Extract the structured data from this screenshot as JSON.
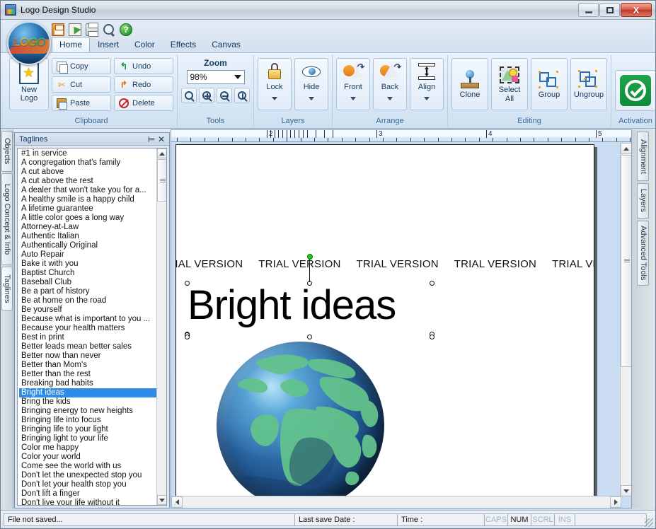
{
  "window": {
    "title": "Logo Design Studio",
    "app_icon": "app-logo-icon",
    "minimize": "–",
    "maximize": "□",
    "close": "X"
  },
  "quick_access": [
    {
      "name": "save-icon",
      "tooltip": "Save"
    },
    {
      "name": "save-as-icon",
      "tooltip": "Save As"
    },
    {
      "name": "print-icon",
      "tooltip": "Print"
    },
    {
      "name": "print-preview-icon",
      "tooltip": "Preview"
    },
    {
      "name": "help-icon",
      "tooltip": "Help",
      "glyph": "?"
    }
  ],
  "tabs": [
    {
      "label": "Home",
      "active": true
    },
    {
      "label": "Insert",
      "active": false
    },
    {
      "label": "Color",
      "active": false
    },
    {
      "label": "Effects",
      "active": false
    },
    {
      "label": "Canvas",
      "active": false
    }
  ],
  "ribbon": {
    "new_logo": {
      "line1": "New",
      "line2": "Logo"
    },
    "clipboard": {
      "label": "Clipboard",
      "buttons": [
        {
          "label": "Copy",
          "icon": "copy-icon"
        },
        {
          "label": "Cut",
          "icon": "cut-icon"
        },
        {
          "label": "Paste",
          "icon": "paste-icon"
        },
        {
          "label": "Undo",
          "icon": "undo-icon"
        },
        {
          "label": "Redo",
          "icon": "redo-icon"
        },
        {
          "label": "Delete",
          "icon": "delete-icon"
        }
      ]
    },
    "zoom": {
      "title": "Zoom",
      "value": "98%",
      "group_label": "Tools",
      "tools": [
        {
          "name": "zoom-select-icon"
        },
        {
          "name": "zoom-in-icon"
        },
        {
          "name": "zoom-out-icon"
        },
        {
          "name": "zoom-fit-icon"
        }
      ]
    },
    "layers": {
      "label": "Layers",
      "buttons": [
        {
          "label": "Lock",
          "icon": "lock-icon"
        },
        {
          "label": "Hide",
          "icon": "eye-icon"
        }
      ]
    },
    "arrange": {
      "label": "Arrange",
      "buttons": [
        {
          "label": "Front",
          "icon": "bring-front-icon"
        },
        {
          "label": "Back",
          "icon": "send-back-icon"
        },
        {
          "label": "Align",
          "icon": "align-icon"
        }
      ]
    },
    "editing": {
      "label": "Editing",
      "buttons": [
        {
          "label": "Clone",
          "icon": "clone-icon"
        },
        {
          "label": "Select All",
          "line1": "Select",
          "line2": "All",
          "icon": "select-all-icon"
        },
        {
          "label": "Group",
          "icon": "group-icon"
        },
        {
          "label": "Ungroup",
          "icon": "ungroup-icon"
        }
      ]
    },
    "activation": {
      "label": "Activation",
      "icon": "activation-check-icon"
    }
  },
  "left_tabs": [
    {
      "label": "Objects",
      "selected": false
    },
    {
      "label": "Logo Concept & Info",
      "selected": false
    },
    {
      "label": "Taglines",
      "selected": true
    }
  ],
  "right_tabs": [
    {
      "label": "Alignment"
    },
    {
      "label": "Layers"
    },
    {
      "label": "Advanced Tools"
    }
  ],
  "panel": {
    "title": "Taglines",
    "pin_icon": "pin-icon",
    "close_icon": "close-icon",
    "selected": "Bright ideas",
    "items": [
      "#1 in service",
      "A congregation that's family",
      "A cut above",
      "A cut above the rest",
      "A dealer that won't take you for a...",
      "A healthy smile is a happy child",
      "A lifetime guarantee",
      "A little color goes a long way",
      "Attorney-at-Law",
      "Authentic Italian",
      "Authentically Original",
      "Auto Repair",
      "Bake it with you",
      "Baptist Church",
      "Baseball Club",
      "Be a part of history",
      "Be at home on the road",
      "Be yourself",
      "Because what is important to you ...",
      "Because your health matters",
      "Best in print",
      "Better leads mean better sales",
      "Better now than never",
      "Better than Mom's",
      "Better than the rest",
      "Breaking bad habits",
      "Bright ideas",
      "Bring the kids",
      "Bringing energy to new heights",
      "Bringing life into focus",
      "Bringing life to your light",
      "Bringing light to your life",
      "Color me happy",
      "Color your world",
      "Come see the world with us",
      "Don't let the unexpected stop you",
      "Don't let your health stop you",
      "Don't lift a finger",
      "Don't live your life without it"
    ]
  },
  "canvas": {
    "ruler_numbers": [
      "2",
      "3",
      "4",
      "5"
    ],
    "watermark_text": "TRIAL VERSION",
    "text_object": "Bright ideas",
    "image_object": "globe-earth-image"
  },
  "statusbar": {
    "message": "File not saved...",
    "last_save_label": "Last save Date :",
    "time_label": "Time :",
    "indicators": [
      {
        "label": "CAPS",
        "active": false
      },
      {
        "label": "NUM",
        "active": true
      },
      {
        "label": "SCRL",
        "active": false
      },
      {
        "label": "INS",
        "active": false
      }
    ]
  },
  "colors": {
    "accent": "#2e8ce6",
    "ribbon_bg": "#dae8f6",
    "activation_green": "#16a24a",
    "close_red": "#bf3a24"
  }
}
